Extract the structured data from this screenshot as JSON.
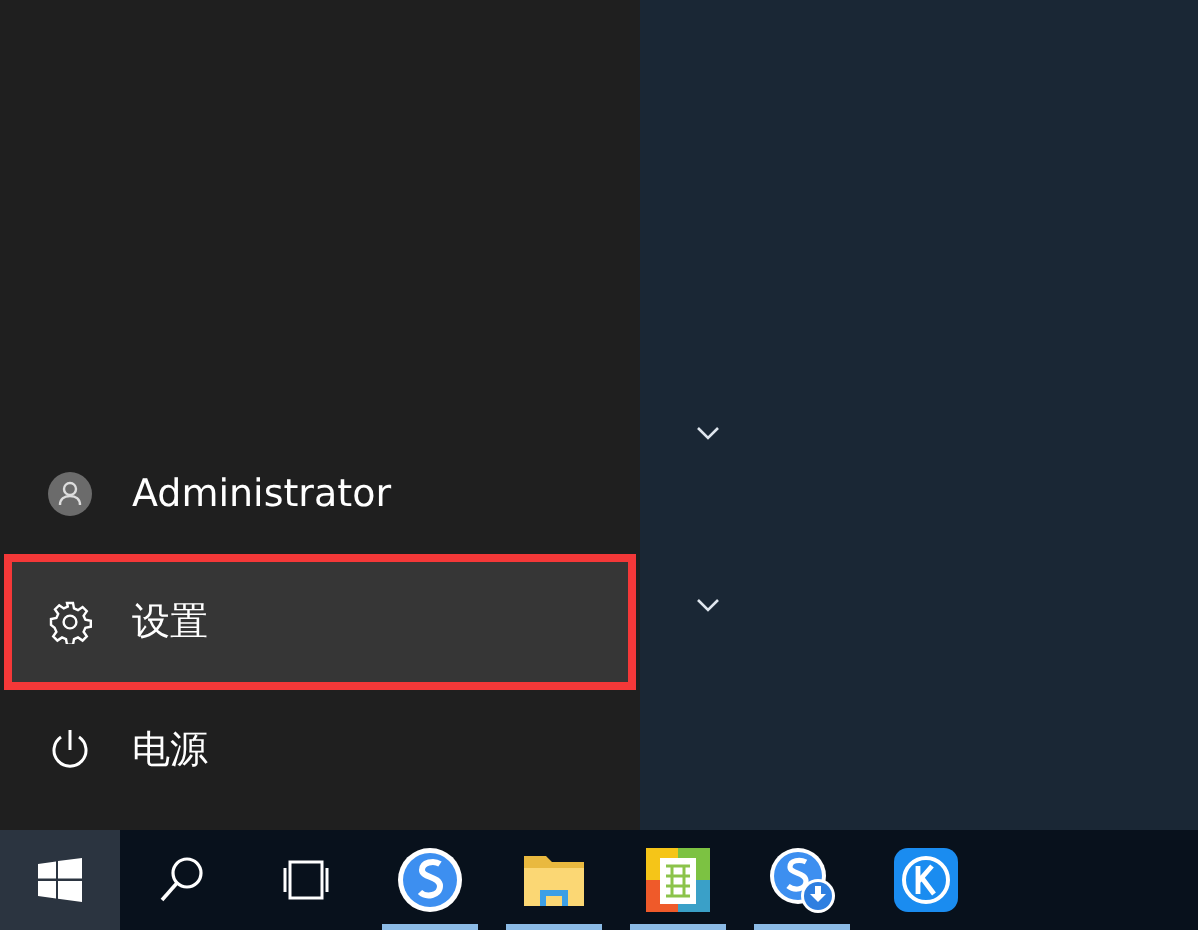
{
  "start_menu": {
    "items": [
      {
        "kind": "user",
        "label": "Administrator",
        "selected": false
      },
      {
        "kind": "settings",
        "label": "设置",
        "selected": true
      },
      {
        "kind": "power",
        "label": "电源",
        "selected": false
      }
    ]
  },
  "tiles": {
    "groups": [
      {
        "expanded": false
      },
      {
        "expanded": false
      }
    ]
  },
  "taskbar": {
    "items": [
      {
        "kind": "start",
        "running": false
      },
      {
        "kind": "search",
        "running": false
      },
      {
        "kind": "taskview",
        "running": false
      },
      {
        "kind": "browser",
        "running": true
      },
      {
        "kind": "folder",
        "running": true
      },
      {
        "kind": "gallery",
        "running": true
      },
      {
        "kind": "download",
        "running": true
      },
      {
        "kind": "k-app",
        "running": false
      }
    ]
  }
}
